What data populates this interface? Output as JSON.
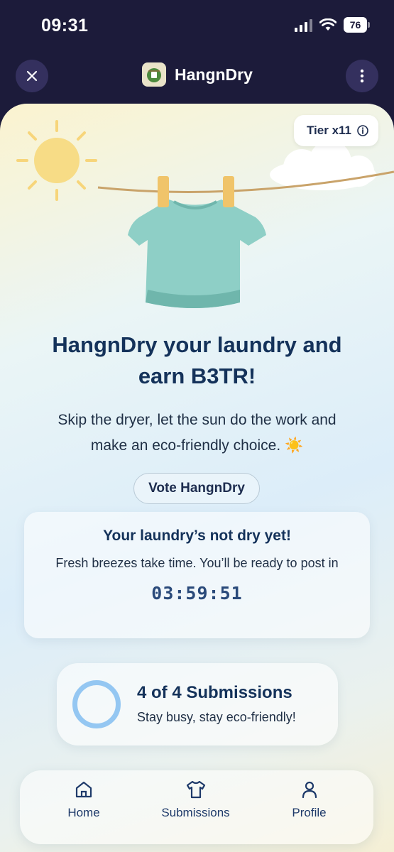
{
  "status_bar": {
    "time": "09:31",
    "battery": "76"
  },
  "header": {
    "title": "HangnDry"
  },
  "tier": {
    "label": "Tier x11"
  },
  "hero": {
    "headline_line1": "HangnDry your laundry and",
    "headline_line2": "earn B3TR!",
    "sub_line1": "Skip the dryer, let the sun do the work and",
    "sub_line2": "make an eco-friendly choice. ☀️"
  },
  "vote_button": {
    "label": "Vote HangnDry"
  },
  "not_dry_card": {
    "title": "Your laundry’s not dry yet!",
    "text": "Fresh breezes take time. You’ll be ready to post in",
    "timer": "03:59:51"
  },
  "submissions": {
    "title": "4 of 4 Submissions",
    "subtitle": "Stay busy, stay eco-friendly!"
  },
  "nav": {
    "items": [
      {
        "label": "Home",
        "icon": "home-icon"
      },
      {
        "label": "Submissions",
        "icon": "shirt-icon"
      },
      {
        "label": "Profile",
        "icon": "user-icon"
      }
    ]
  },
  "colors": {
    "header_bg": "#1c1b3a",
    "headline": "#14325a",
    "ring": "#94c7f2",
    "shirt": "#8ecfc6",
    "clothespin": "#f0c46a"
  }
}
